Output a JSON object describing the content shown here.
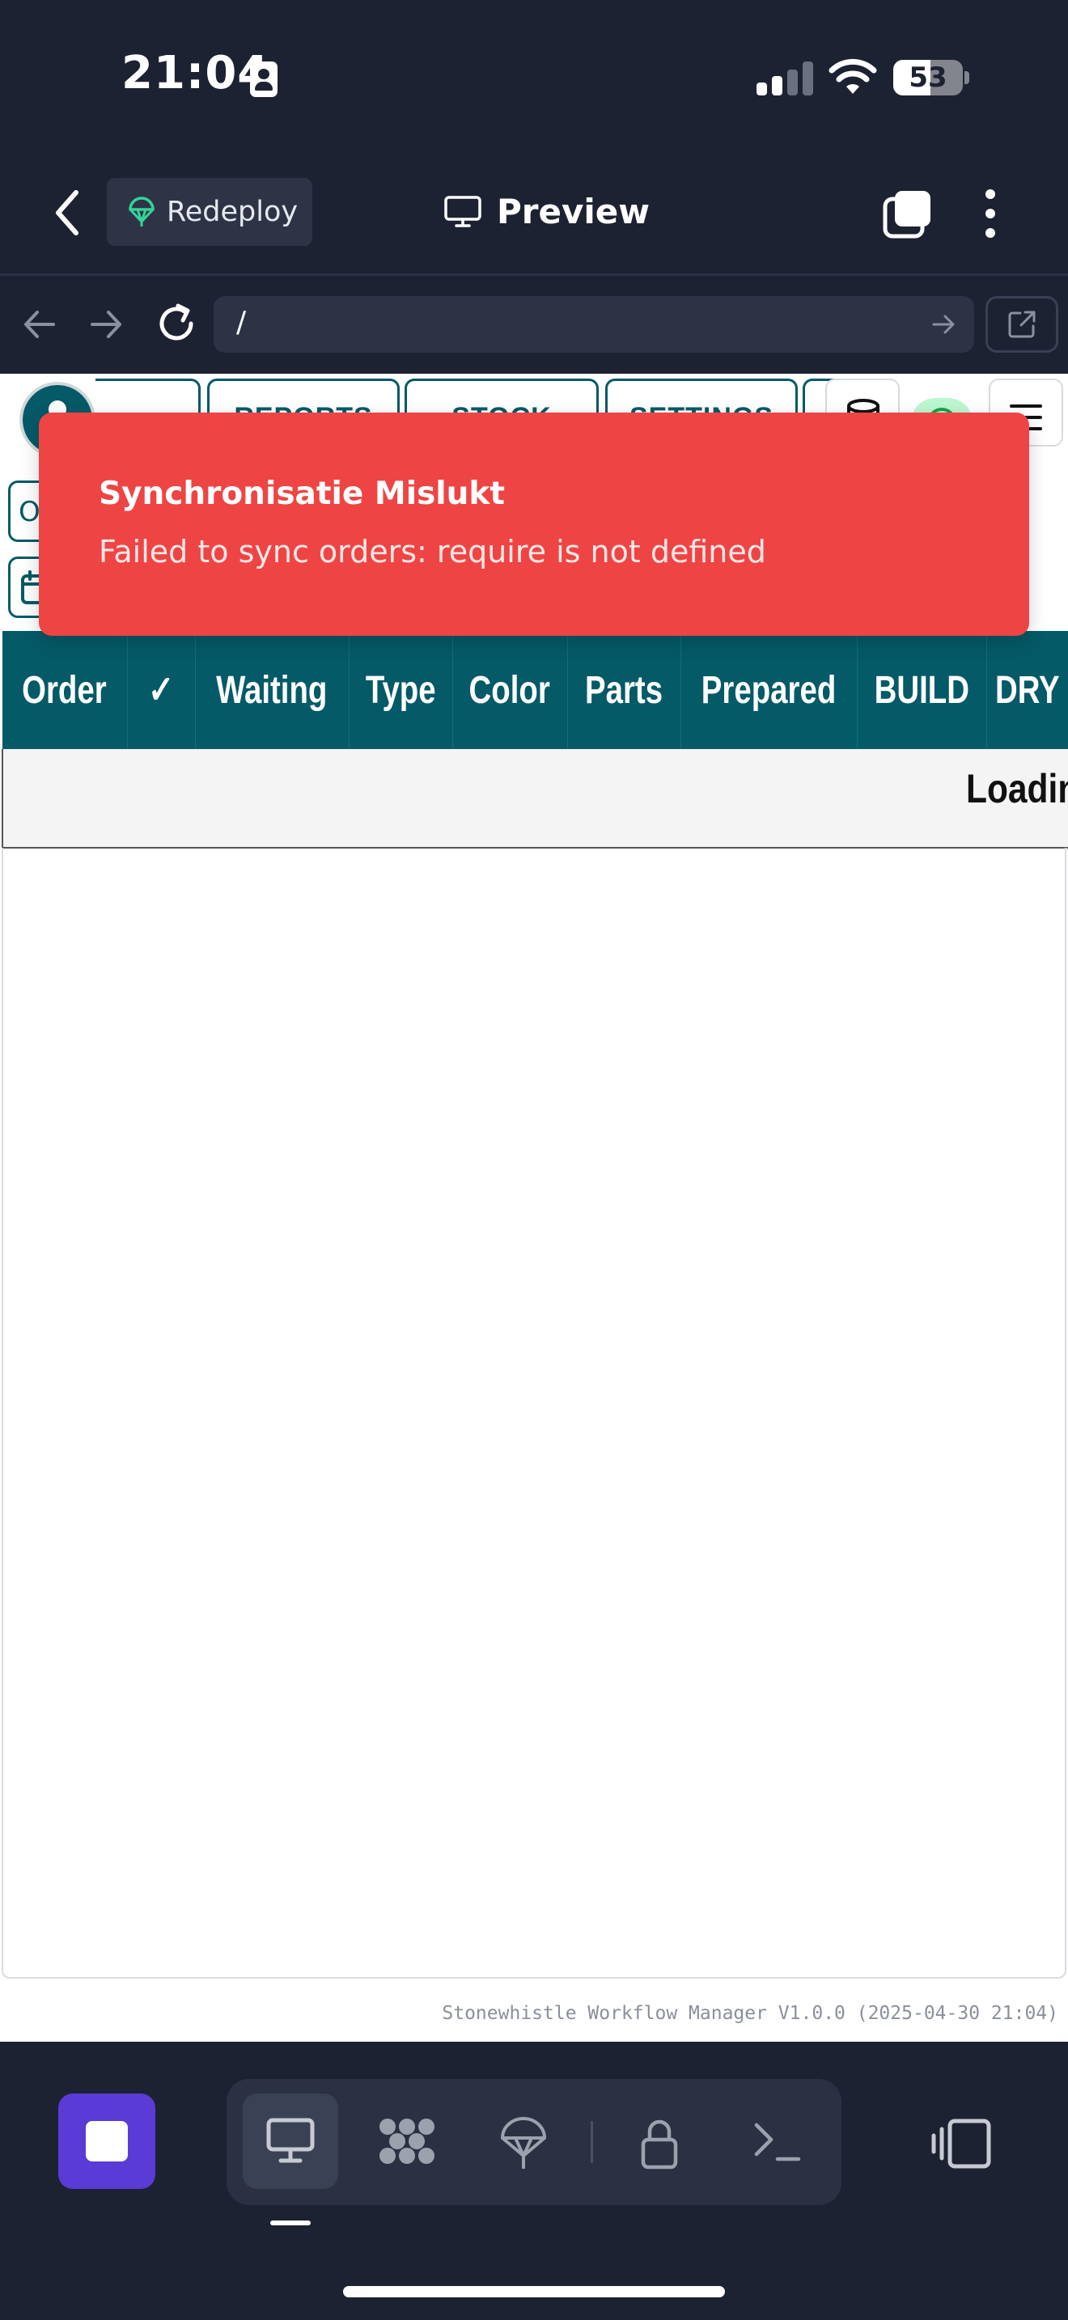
{
  "status_bar": {
    "time": "21:04",
    "battery_level": "53",
    "battery_percent": 53,
    "signal_bars_active": 2,
    "signal_bars_total": 4
  },
  "header": {
    "back_icon": "chevron-left-icon",
    "redeploy_label": "Redeploy",
    "redeploy_icon": "parachute-icon",
    "title": "Preview",
    "title_icon": "monitor-icon",
    "tabs_icon": "tabs-icon",
    "more_icon": "more-vertical-icon"
  },
  "browser": {
    "url": "/",
    "back_icon": "arrow-left-icon",
    "forward_icon": "arrow-right-icon",
    "reload_icon": "reload-icon",
    "go_icon": "arrow-right-icon",
    "external_icon": "external-link-icon"
  },
  "site": {
    "nav_tabs": [
      "REPORTS",
      "STOCK",
      "SETTINGS"
    ],
    "filter_first_label": "O",
    "table_headers": [
      "Order",
      "✓",
      "Waiting",
      "Type",
      "Color",
      "Parts",
      "Prepared",
      "BUILD",
      "DRY"
    ],
    "loading_text": "Loading",
    "footer": "Stonewhistle Workflow Manager V1.0.0 (2025-04-30 21:04)",
    "accent_color": "#055a68"
  },
  "toast": {
    "title": "Synchronisatie Mislukt",
    "message": "Failed to sync orders: require is not defined",
    "color": "#ef4444"
  },
  "toolbar": {
    "stop_icon": "stop-icon",
    "tools": [
      "monitor-icon",
      "grid-icon",
      "parachute-icon",
      "lock-icon",
      "terminal-icon"
    ],
    "device_icon": "device-toggle-icon",
    "accent_color": "#5b3bd6"
  }
}
